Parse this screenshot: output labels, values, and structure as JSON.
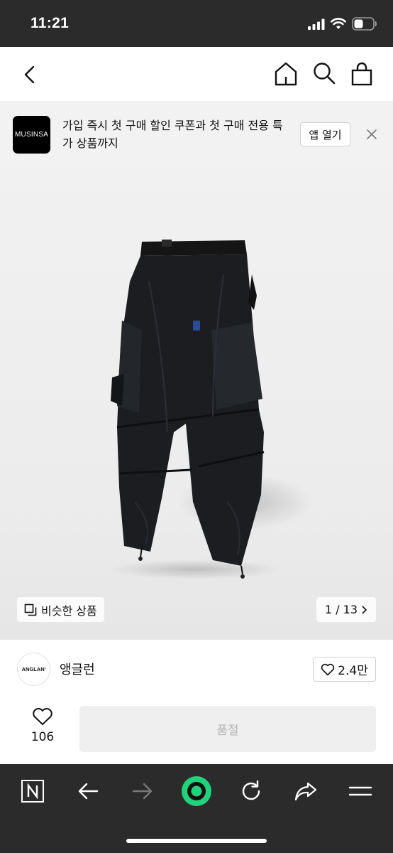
{
  "status_bar": {
    "time": "11:21"
  },
  "app_banner": {
    "logo_text": "MUSINSA",
    "message": "가입 즉시 첫 구매 할인 쿠폰과 첫 구매 전용 특가 상품까지",
    "open_button": "앱 열기"
  },
  "product_image": {
    "similar_button": "비슷한 상품",
    "counter": "1 / 13"
  },
  "brand": {
    "logo_text": "ANGLAN'",
    "name": "앵글런",
    "like_count": "2.4만"
  },
  "purchase_bar": {
    "wish_count": "106",
    "soldout_label": "품절"
  },
  "colors": {
    "dark_chrome": "#2b2b2b",
    "toolbar_accent": "#1ed47a",
    "disabled_text": "#b5b5b5"
  }
}
